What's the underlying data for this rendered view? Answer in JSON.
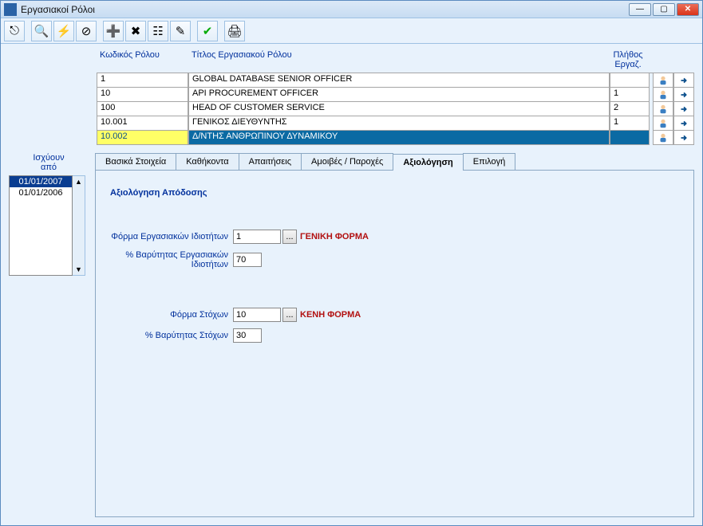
{
  "window": {
    "title": "Εργασιακοί Ρόλοι"
  },
  "grid": {
    "headers": {
      "code": "Κωδικός Ρόλου",
      "title": "Τίτλος Εργασιακού Ρόλου",
      "count": "Πλήθος Εργαζ."
    },
    "rows": [
      {
        "code": "1",
        "title": "GLOBAL DATABASE SENIOR OFFICER",
        "count": ""
      },
      {
        "code": "10",
        "title": "API PROCUREMENT OFFICER",
        "count": "1"
      },
      {
        "code": "100",
        "title": "HEAD OF CUSTOMER SERVICE",
        "count": "2"
      },
      {
        "code": "10.001",
        "title": "ΓΕΝΙΚΟΣ ΔΙΕΥΘΥΝΤΗΣ",
        "count": "1"
      },
      {
        "code": "10.002",
        "title": "Δ/ΝΤΗΣ ΑΝΘΡΩΠΙΝΟΥ ΔΥΝΑΜΙΚΟΥ",
        "count": "",
        "selected": true
      }
    ]
  },
  "left": {
    "label_l1": "Ισχύουν",
    "label_l2": "από",
    "dates": [
      {
        "v": "01/01/2007",
        "selected": true
      },
      {
        "v": "01/01/2006"
      }
    ]
  },
  "tabs": {
    "items": [
      {
        "label": "Βασικά Στοιχεία"
      },
      {
        "label": "Καθήκοντα"
      },
      {
        "label": "Απαιτήσεις"
      },
      {
        "label": "Αμοιβές / Παροχές"
      },
      {
        "label": "Αξιολόγηση",
        "active": true
      },
      {
        "label": "Επιλογή"
      }
    ]
  },
  "eval": {
    "section_title": "Αξιολόγηση Απόδοσης",
    "form_traits_label": "Φόρμα Εργασιακών Ιδιοτήτων",
    "form_traits_value": "1",
    "form_traits_name": "ΓΕΝΙΚΗ ΦΟΡΜΑ",
    "weight_traits_label": "% Βαρύτητας Εργασιακών Ιδιοτήτων",
    "weight_traits_value": "70",
    "form_goals_label": "Φόρμα Στόχων",
    "form_goals_value": "10",
    "form_goals_name": "ΚΕΝΗ ΦΟΡΜΑ",
    "weight_goals_label": "% Βαρύτητας Στόχων",
    "weight_goals_value": "30",
    "dots": "..."
  }
}
